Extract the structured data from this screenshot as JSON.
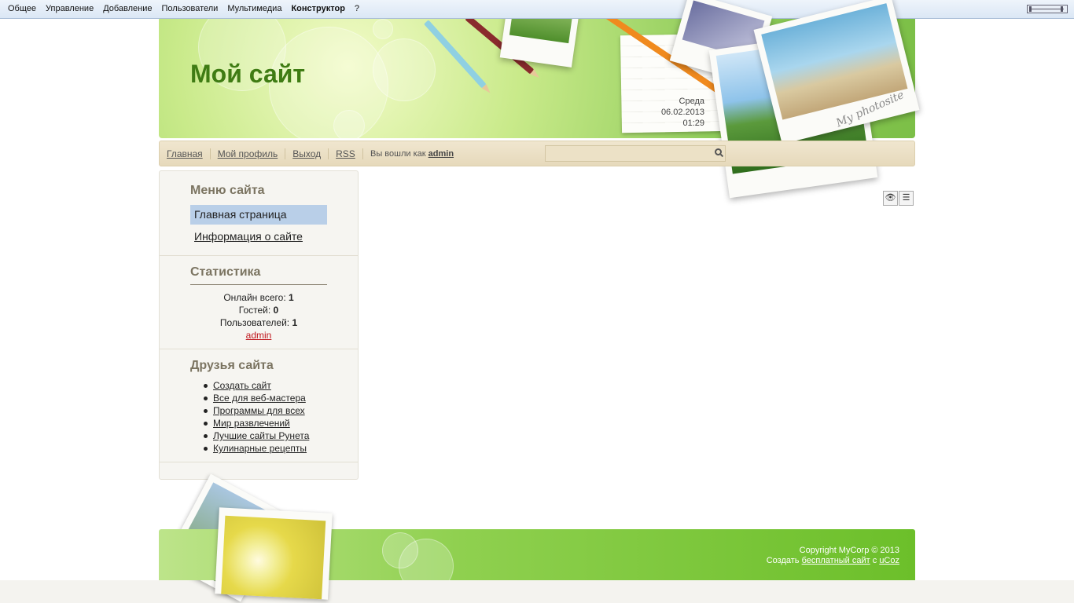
{
  "admin_bar": {
    "items": [
      "Общее",
      "Управление",
      "Добавление",
      "Пользователи",
      "Мультимедиа",
      "Конструктор",
      "?"
    ]
  },
  "header": {
    "site_title": "Мой сайт",
    "day": "Среда",
    "date": "06.02.2013",
    "time": "01:29",
    "photo_caption": "My photosite"
  },
  "nav": {
    "links": [
      "Главная",
      "Мой профиль",
      "Выход",
      "RSS"
    ],
    "logged_prefix": "Вы вошли как",
    "logged_user": "admin",
    "search_placeholder": ""
  },
  "sidebar": {
    "menu_title": "Меню сайта",
    "menu_items": [
      "Главная страница",
      "Информация о сайте"
    ],
    "stats_title": "Статистика",
    "stats": {
      "online_label": "Онлайн всего:",
      "online_value": "1",
      "guests_label": "Гостей:",
      "guests_value": "0",
      "users_label": "Пользователей:",
      "users_value": "1",
      "user_name": "admin"
    },
    "friends_title": "Друзья сайта",
    "friends": [
      "Создать сайт",
      "Все для веб-мастера",
      "Программы для всех",
      "Мир развлечений",
      "Лучшие сайты Рунета",
      "Кулинарные рецепты"
    ]
  },
  "footer": {
    "copyright": "Copyright MyCorp © 2013",
    "create_prefix": "Создать",
    "create_link": "бесплатный сайт",
    "create_mid": "с",
    "create_brand": "uCoz"
  },
  "colors": {
    "title_green": "#3f7c14",
    "nav_bg": "#e6d9bb",
    "active_menu": "#b9cfe8",
    "user_red": "#c0171d"
  }
}
